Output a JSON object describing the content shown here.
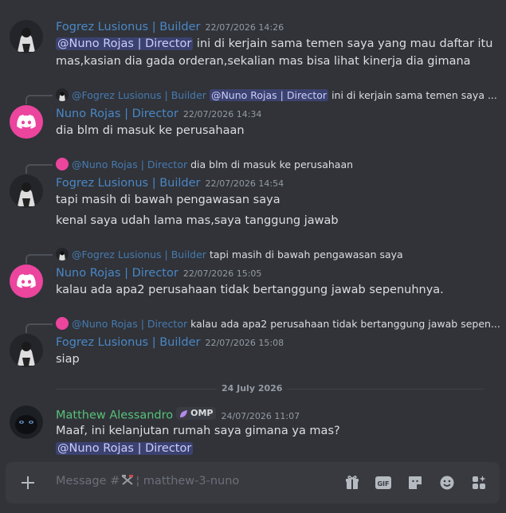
{
  "messages": [
    {
      "author": "Fogrez Lusionus | Builder",
      "timestamp": "22/07/2026 14:26",
      "mention": "@Nuno Rojas | Director",
      "line1": " ini di kerjain sama temen saya yang mau daftar itu",
      "line2": "mas,kasian dia gada orderan,sekalian mas bisa lihat kinerja dia gimana"
    },
    {
      "reply_name": "@Fogrez Lusionus | Builder",
      "reply_mention": "@Nuno Rojas | Director",
      "reply_text": "ini di kerjain sama temen saya ...",
      "author": "Nuno Rojas | Director",
      "timestamp": "22/07/2026 14:34",
      "line1": "dia blm di masuk ke perusahaan"
    },
    {
      "reply_name": "@Nuno Rojas | Director",
      "reply_text": "dia blm di masuk ke perusahaan",
      "author": "Fogrez Lusionus | Builder",
      "timestamp": "22/07/2026 14:54",
      "line1": "tapi masih di bawah pengawasan saya",
      "line2": "kenal saya udah lama mas,saya tanggung jawab"
    },
    {
      "reply_name": "@Fogrez Lusionus | Builder",
      "reply_text": "tapi masih di bawah pengawasan saya",
      "author": "Nuno Rojas | Director",
      "timestamp": "22/07/2026 15:05",
      "line1": "kalau ada apa2 perusahaan tidak bertanggung jawab sepenuhnya."
    },
    {
      "reply_name": "@Nuno Rojas | Director",
      "reply_text": "kalau ada apa2 perusahaan tidak bertanggung jawab sepen...",
      "author": "Fogrez Lusionus | Builder",
      "timestamp": "22/07/2026 15:08",
      "line1": "siap"
    },
    {
      "author": "Matthew Alessandro",
      "badge": "OMP",
      "timestamp": "24/07/2026 11:07",
      "line1": "Maaf, ini kelanjutan rumah saya gimana ya mas?",
      "mention": "@Nuno Rojas | Director"
    }
  ],
  "date_divider": "24 July 2026",
  "composer": {
    "placeholder_prefix": "Message #",
    "placeholder_channel": "¦ matthew-3-nuno"
  },
  "colors": {
    "background": "#313338",
    "builder_name": "#4a87c6",
    "member_name": "#57c27a",
    "mention_bg": "#3c4270",
    "discord_pink": "#eb459e"
  },
  "icons": [
    "plus-icon",
    "gift-icon",
    "gif-icon",
    "sticker-icon",
    "emoji-icon",
    "apps-icon",
    "hammer-pick-icon"
  ]
}
